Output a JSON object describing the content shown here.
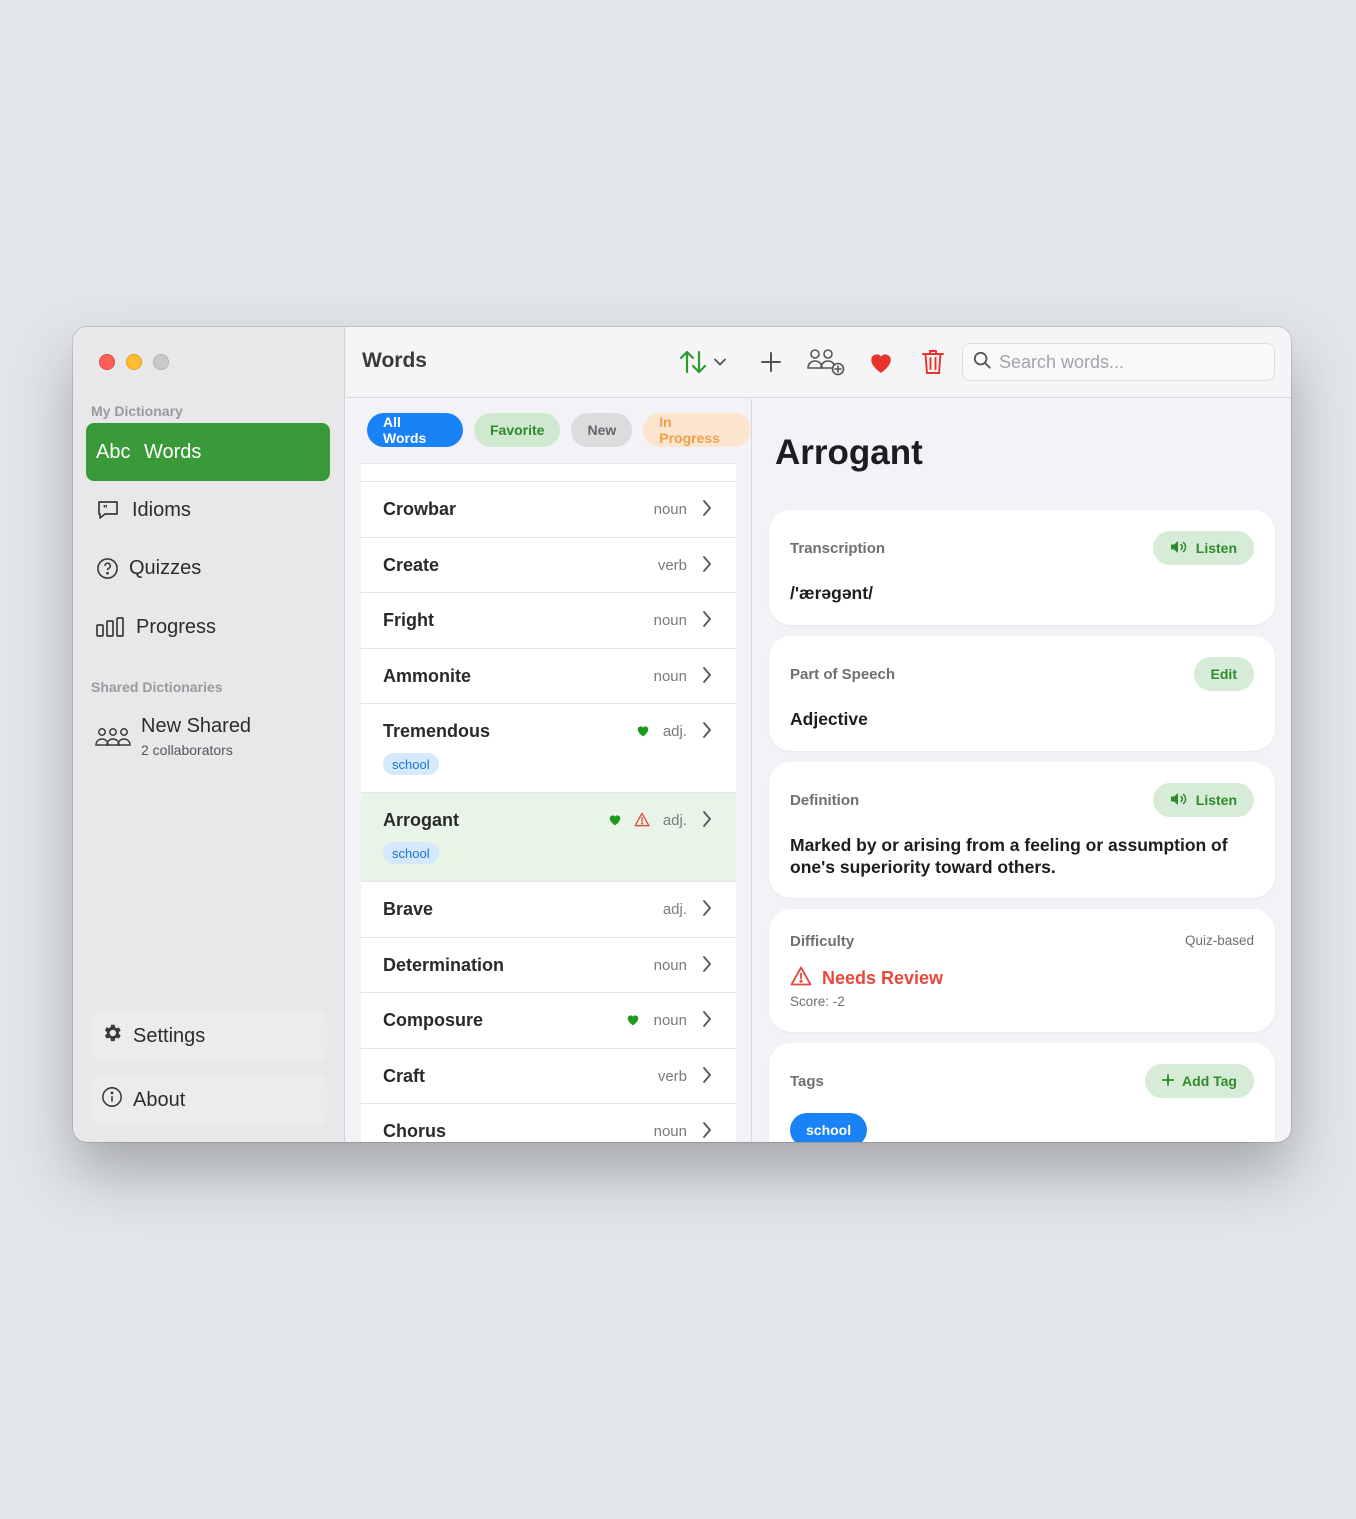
{
  "sidebar": {
    "my_dictionary_heading": "My Dictionary",
    "items": [
      {
        "label": "Words",
        "icon_text": "Abc",
        "icon": "abc-icon"
      },
      {
        "label": "Idioms",
        "icon": "quote-bubble-icon"
      },
      {
        "label": "Quizzes",
        "icon": "question-circle-icon"
      },
      {
        "label": "Progress",
        "icon": "bar-chart-icon"
      }
    ],
    "shared_heading": "Shared Dictionaries",
    "shared": {
      "name": "New Shared",
      "subtitle": "2 collaborators",
      "icon": "people-group-icon"
    },
    "settings_label": "Settings",
    "about_label": "About"
  },
  "toolbar": {
    "title": "Words",
    "search_placeholder": "Search words...",
    "icons": [
      "sort-icon",
      "chevron-down-icon",
      "plus-icon",
      "add-people-icon",
      "heart-icon",
      "trash-icon",
      "search-icon"
    ]
  },
  "filters": [
    "All Words",
    "Favorite",
    "New",
    "In Progress"
  ],
  "words": [
    {
      "word": "Crowbar",
      "pos": "noun"
    },
    {
      "word": "Create",
      "pos": "verb"
    },
    {
      "word": "Fright",
      "pos": "noun"
    },
    {
      "word": "Ammonite",
      "pos": "noun"
    },
    {
      "word": "Tremendous",
      "pos": "adj.",
      "favorite": true,
      "tag": "school"
    },
    {
      "word": "Arrogant",
      "pos": "adj.",
      "favorite": true,
      "warning": true,
      "tag": "school",
      "selected": true
    },
    {
      "word": "Brave",
      "pos": "adj."
    },
    {
      "word": "Determination",
      "pos": "noun"
    },
    {
      "word": "Composure",
      "pos": "noun",
      "favorite": true
    },
    {
      "word": "Craft",
      "pos": "verb"
    },
    {
      "word": "Chorus",
      "pos": "noun"
    }
  ],
  "detail": {
    "title": "Arrogant",
    "transcription": {
      "label": "Transcription",
      "value": "/'ærəgənt/",
      "button": "Listen"
    },
    "part_of_speech": {
      "label": "Part of Speech",
      "value": "Adjective",
      "button": "Edit"
    },
    "definition": {
      "label": "Definition",
      "value": "Marked by or arising from a feeling or assumption of one's superiority toward others.",
      "button": "Listen"
    },
    "difficulty": {
      "label": "Difficulty",
      "mode": "Quiz-based",
      "status": "Needs Review",
      "score": "Score: -2"
    },
    "tags": {
      "label": "Tags",
      "button": "Add Tag",
      "items": [
        "school"
      ]
    }
  },
  "colors": {
    "accent_green": "#3a9a3a",
    "accent_blue": "#1a82f7",
    "favorite_red": "#e8473c",
    "heart_green": "#1e9a1e"
  }
}
